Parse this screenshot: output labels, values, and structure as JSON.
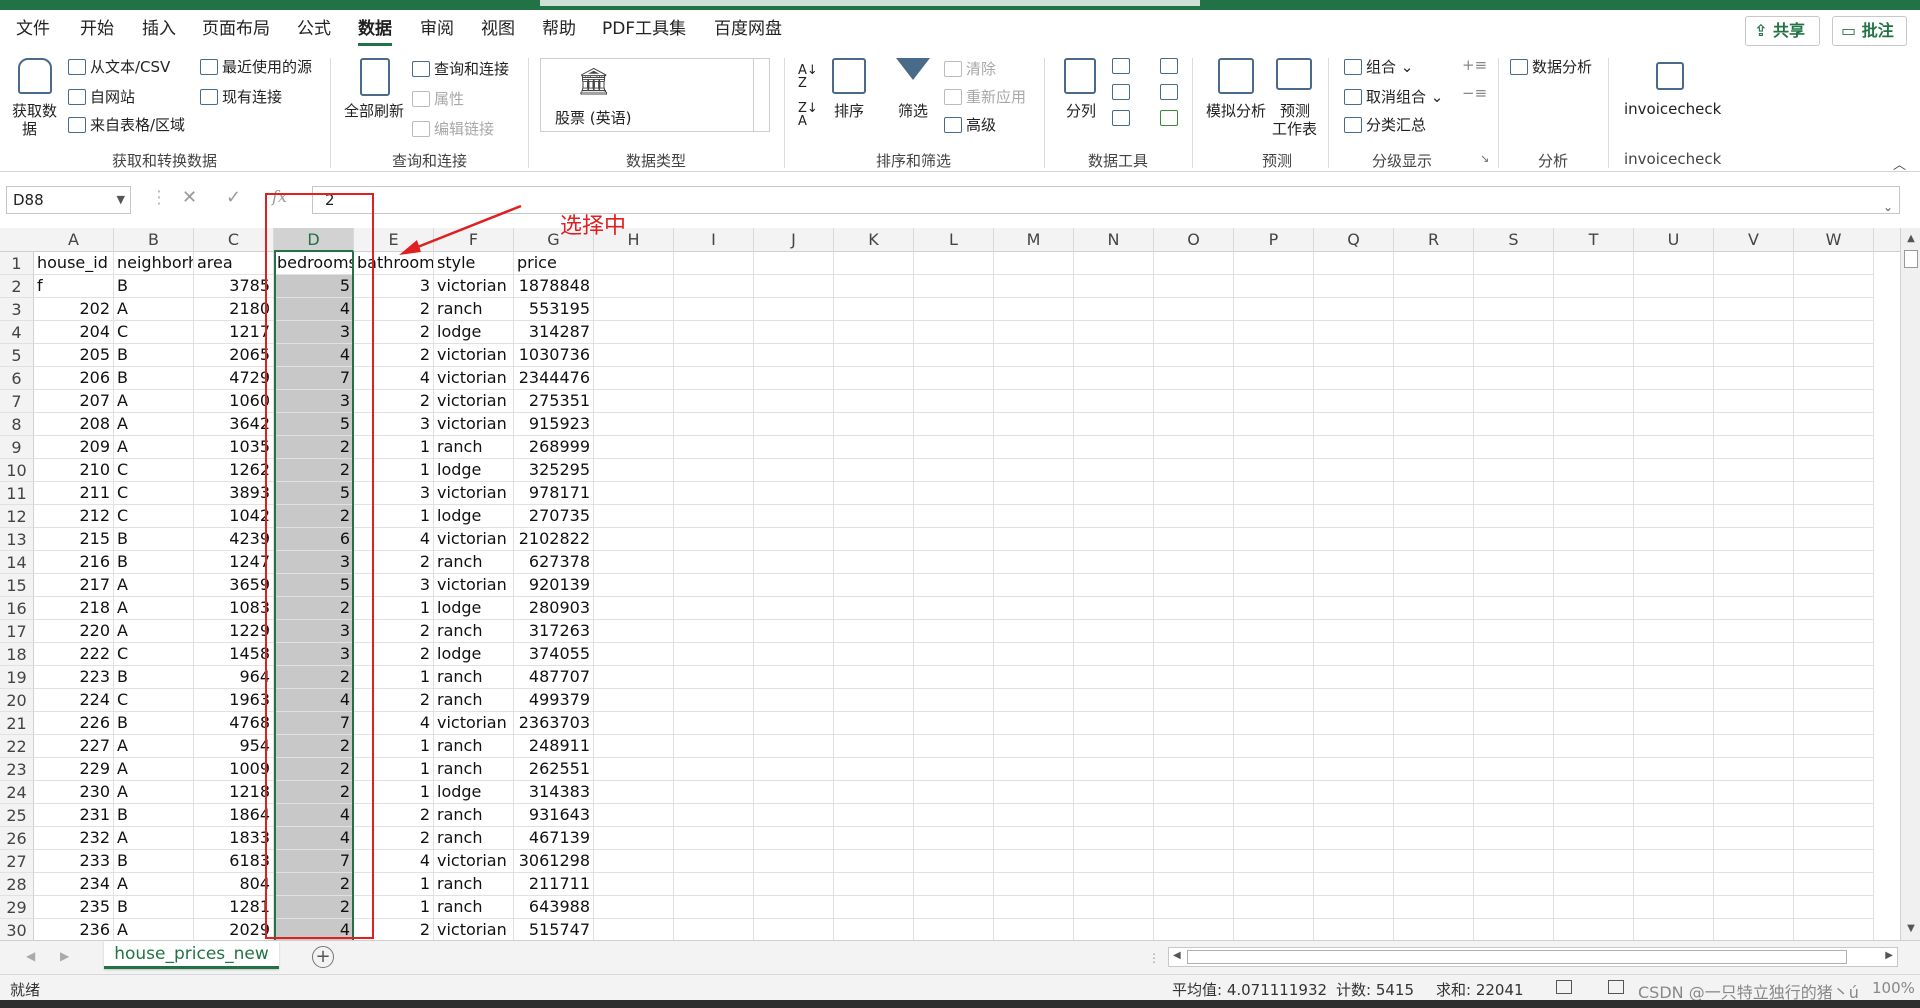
{
  "ribbon_tabs": [
    "文件",
    "开始",
    "插入",
    "页面布局",
    "公式",
    "数据",
    "审阅",
    "视图",
    "帮助",
    "PDF工具集",
    "百度网盘"
  ],
  "active_tab": "数据",
  "share_label": "共享",
  "note_label": "批注",
  "ribbon": {
    "get_data": "获取数",
    "get_data2": "据",
    "from_text": "从文本/CSV",
    "from_web": "自网站",
    "from_table": "来自表格/区域",
    "recent_sources": "最近使用的源",
    "existing_conn": "现有连接",
    "group1": "获取和转换数据",
    "refresh_all": "全部刷新",
    "queries_conn": "查询和连接",
    "properties": "属性",
    "edit_links": "编辑链接",
    "group2": "查询和连接",
    "stock": "股票 (英语)",
    "group3": "数据类型",
    "sort": "排序",
    "filter": "筛选",
    "clear": "清除",
    "reapply": "重新应用",
    "advanced": "高级",
    "group4": "排序和筛选",
    "text_to_cols": "分列",
    "group5": "数据工具",
    "whatif": "模拟分析",
    "forecast_sheet": "预测",
    "forecast_sheet2": "工作表",
    "group6": "预测",
    "group_btn": "组合",
    "ungroup_btn": "取消组合",
    "subtotal": "分类汇总",
    "group7": "分级显示",
    "data_analysis": "数据分析",
    "group8": "分析",
    "invoicecheck": "invoicecheck",
    "group9": "invoicecheck"
  },
  "formula_bar": {
    "name_box": "D88",
    "fx": "fx",
    "value": "2"
  },
  "annotation": "选择中",
  "columns": [
    "A",
    "B",
    "C",
    "D",
    "E",
    "F",
    "G",
    "H",
    "I",
    "J",
    "K",
    "L",
    "M",
    "N",
    "O",
    "P",
    "Q",
    "R",
    "S",
    "T",
    "U",
    "V",
    "W"
  ],
  "selected_column": "D",
  "rows": [
    {
      "n": "1",
      "a": "house_id",
      "b": "neighborh",
      "c": "area",
      "d": "bedrooms",
      "e": "bathroom",
      "f": "style",
      "g": "price"
    },
    {
      "n": "2",
      "a": "f",
      "b": "B",
      "c": "3785",
      "d": "5",
      "e": "3",
      "f": "victorian",
      "g": "1878848"
    },
    {
      "n": "3",
      "a": "202",
      "b": "A",
      "c": "2180",
      "d": "4",
      "e": "2",
      "f": "ranch",
      "g": "553195"
    },
    {
      "n": "4",
      "a": "204",
      "b": "C",
      "c": "1217",
      "d": "3",
      "e": "2",
      "f": "lodge",
      "g": "314287"
    },
    {
      "n": "5",
      "a": "205",
      "b": "B",
      "c": "2065",
      "d": "4",
      "e": "2",
      "f": "victorian",
      "g": "1030736"
    },
    {
      "n": "6",
      "a": "206",
      "b": "B",
      "c": "4729",
      "d": "7",
      "e": "4",
      "f": "victorian",
      "g": "2344476"
    },
    {
      "n": "7",
      "a": "207",
      "b": "A",
      "c": "1060",
      "d": "3",
      "e": "2",
      "f": "victorian",
      "g": "275351"
    },
    {
      "n": "8",
      "a": "208",
      "b": "A",
      "c": "3642",
      "d": "5",
      "e": "3",
      "f": "victorian",
      "g": "915923"
    },
    {
      "n": "9",
      "a": "209",
      "b": "A",
      "c": "1035",
      "d": "2",
      "e": "1",
      "f": "ranch",
      "g": "268999"
    },
    {
      "n": "10",
      "a": "210",
      "b": "C",
      "c": "1262",
      "d": "2",
      "e": "1",
      "f": "lodge",
      "g": "325295"
    },
    {
      "n": "11",
      "a": "211",
      "b": "C",
      "c": "3893",
      "d": "5",
      "e": "3",
      "f": "victorian",
      "g": "978171"
    },
    {
      "n": "12",
      "a": "212",
      "b": "C",
      "c": "1042",
      "d": "2",
      "e": "1",
      "f": "lodge",
      "g": "270735"
    },
    {
      "n": "13",
      "a": "215",
      "b": "B",
      "c": "4239",
      "d": "6",
      "e": "4",
      "f": "victorian",
      "g": "2102822"
    },
    {
      "n": "14",
      "a": "216",
      "b": "B",
      "c": "1247",
      "d": "3",
      "e": "2",
      "f": "ranch",
      "g": "627378"
    },
    {
      "n": "15",
      "a": "217",
      "b": "A",
      "c": "3659",
      "d": "5",
      "e": "3",
      "f": "victorian",
      "g": "920139"
    },
    {
      "n": "16",
      "a": "218",
      "b": "A",
      "c": "1083",
      "d": "2",
      "e": "1",
      "f": "lodge",
      "g": "280903"
    },
    {
      "n": "17",
      "a": "220",
      "b": "A",
      "c": "1229",
      "d": "3",
      "e": "2",
      "f": "ranch",
      "g": "317263"
    },
    {
      "n": "18",
      "a": "222",
      "b": "C",
      "c": "1458",
      "d": "3",
      "e": "2",
      "f": "lodge",
      "g": "374055"
    },
    {
      "n": "19",
      "a": "223",
      "b": "B",
      "c": "964",
      "d": "2",
      "e": "1",
      "f": "ranch",
      "g": "487707"
    },
    {
      "n": "20",
      "a": "224",
      "b": "C",
      "c": "1963",
      "d": "4",
      "e": "2",
      "f": "ranch",
      "g": "499379"
    },
    {
      "n": "21",
      "a": "226",
      "b": "B",
      "c": "4768",
      "d": "7",
      "e": "4",
      "f": "victorian",
      "g": "2363703"
    },
    {
      "n": "22",
      "a": "227",
      "b": "A",
      "c": "954",
      "d": "2",
      "e": "1",
      "f": "ranch",
      "g": "248911"
    },
    {
      "n": "23",
      "a": "229",
      "b": "A",
      "c": "1009",
      "d": "2",
      "e": "1",
      "f": "ranch",
      "g": "262551"
    },
    {
      "n": "24",
      "a": "230",
      "b": "A",
      "c": "1218",
      "d": "2",
      "e": "1",
      "f": "lodge",
      "g": "314383"
    },
    {
      "n": "25",
      "a": "231",
      "b": "B",
      "c": "1864",
      "d": "4",
      "e": "2",
      "f": "ranch",
      "g": "931643"
    },
    {
      "n": "26",
      "a": "232",
      "b": "A",
      "c": "1833",
      "d": "4",
      "e": "2",
      "f": "ranch",
      "g": "467139"
    },
    {
      "n": "27",
      "a": "233",
      "b": "B",
      "c": "6183",
      "d": "7",
      "e": "4",
      "f": "victorian",
      "g": "3061298"
    },
    {
      "n": "28",
      "a": "234",
      "b": "A",
      "c": "804",
      "d": "2",
      "e": "1",
      "f": "ranch",
      "g": "211711"
    },
    {
      "n": "29",
      "a": "235",
      "b": "B",
      "c": "1281",
      "d": "2",
      "e": "1",
      "f": "ranch",
      "g": "643988"
    },
    {
      "n": "30",
      "a": "236",
      "b": "A",
      "c": "2029",
      "d": "4",
      "e": "2",
      "f": "victorian",
      "g": "515747"
    }
  ],
  "sheet_tab": "house_prices_new",
  "status": {
    "ready": "就绪",
    "average": "平均值: 4.071111932",
    "count": "计数: 5415",
    "sum": "求和: 22041",
    "zoom": "100%"
  },
  "watermark": "CSDN @一只特立独行的猪丶ú",
  "colors": {
    "excel_green": "#217346",
    "annotation_red": "#e02020",
    "selection_gray": "#c8c8c8"
  }
}
